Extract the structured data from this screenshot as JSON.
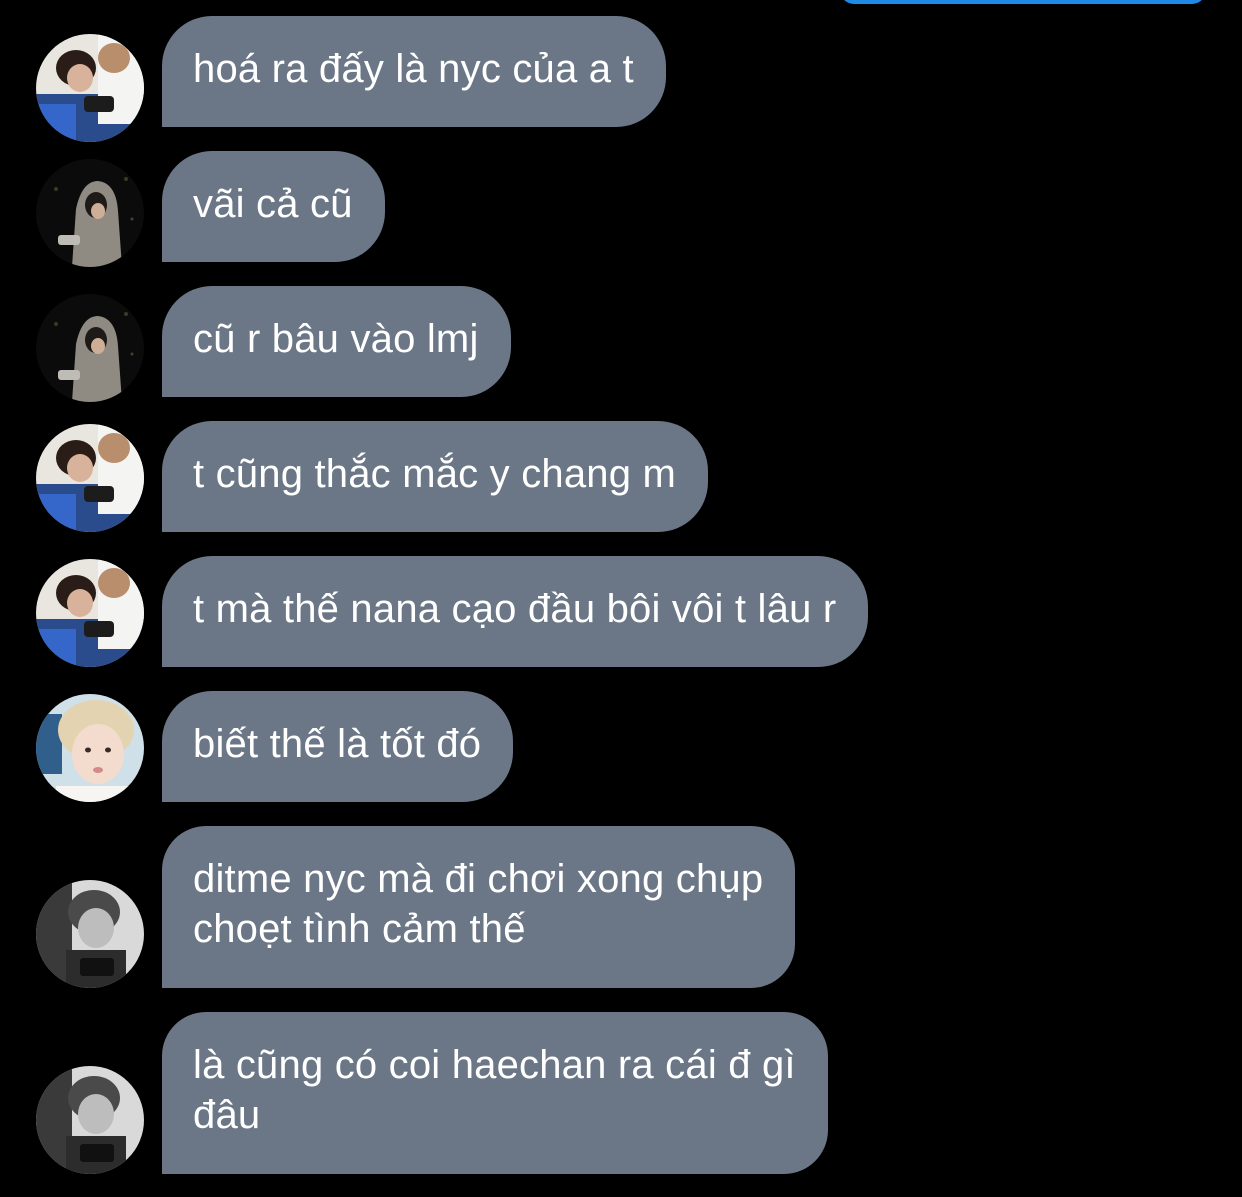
{
  "colors": {
    "background": "#000000",
    "received_bubble": "#6b7786",
    "bubble_text": "#ffffff",
    "sent_bubble_edge": "#1d8ae8"
  },
  "messages": [
    {
      "sender": "user-a",
      "lines": [
        "hoá ra đấy là nyc của a t"
      ]
    },
    {
      "sender": "user-b",
      "lines": [
        "vãi cả cũ"
      ]
    },
    {
      "sender": "user-b",
      "lines": [
        "cũ r bâu vào lmj"
      ]
    },
    {
      "sender": "user-a",
      "lines": [
        "t cũng thắc mắc y chang m"
      ]
    },
    {
      "sender": "user-a",
      "lines": [
        "t mà thế nana cạo đầu bôi vôi t lâu r"
      ]
    },
    {
      "sender": "user-c",
      "lines": [
        "biết thế là tốt đó"
      ]
    },
    {
      "sender": "user-d",
      "lines": [
        "ditme nyc mà đi chơi xong chụp",
        "choẹt tình cảm thế"
      ]
    },
    {
      "sender": "user-d",
      "lines": [
        "là cũng có coi haechan ra cái đ gì",
        "đâu"
      ]
    }
  ]
}
